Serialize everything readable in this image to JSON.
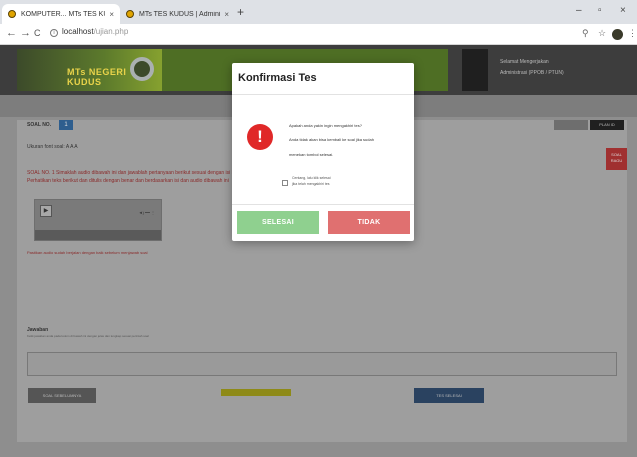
{
  "browser": {
    "tabs": [
      {
        "title": "KOMPUTER... MTs TES KUDUS",
        "active": true
      },
      {
        "title": "MTs TES KUDUS | Administrasi",
        "active": false
      }
    ],
    "new_tab": "+",
    "window_controls": {
      "minimize": "–",
      "maximize": "▫",
      "close": "×"
    },
    "nav": {
      "back": "←",
      "forward": "→",
      "reload": "C"
    },
    "url": {
      "host": "localhost",
      "path": "/ujian.php"
    }
  },
  "header": {
    "logo_text": "MTs NEGERI KUDUS",
    "user_lines": [
      "Selamat Mengerjakan",
      "Administrasi (PPOB / PTUN)"
    ]
  },
  "main": {
    "soal_label": "SOAL NO.",
    "soal_number": "1",
    "right_button_b": "PLAN ID",
    "font_size_label": "Ukuran font soal:  A  A  A",
    "red_tab_text": "SOAL RAGU",
    "question_lines": [
      "SOAL NO. 1  Simaklah audio dibawah ini dan jawablah pertanyaan berikut sesuai dengan isi bacaan",
      "Perhatikan teks berikut dan ditulis dengan benar dan berdasarkan isi dan audio dibawah ini"
    ],
    "audio_play": "▶",
    "audio_volume": "◄) ━━ ⋮",
    "note": "Pastikan audio sudah berjalan dengan baik sebelum menjawab soal",
    "answer_label": "Jawaban",
    "answer_hint": "Ketik jawaban anda pada kolom di bawah ini dengan jelas dan lengkap sesuai perintah soal",
    "btn_prev": "SOAL SEBELUMNYA",
    "btn_next": "TES SELESAI"
  },
  "modal": {
    "title": "Konfirmasi Tes",
    "warning_glyph": "!",
    "message_lines": [
      "Apakah anda yakin ingin mengakhiri tes?",
      "Anda tidak akan bisa kembali ke soal jika sudah",
      "menekan tombol selesai."
    ],
    "checkbox_lines": [
      "Centang, lalu klik selesai",
      "jika telah mengakhiri tes"
    ],
    "btn_selesai": "SELESAI",
    "btn_tidak": "TIDAK"
  },
  "colors": {
    "selesai": "#8fd08f",
    "tidak": "#e07070",
    "warning": "#e02828"
  }
}
